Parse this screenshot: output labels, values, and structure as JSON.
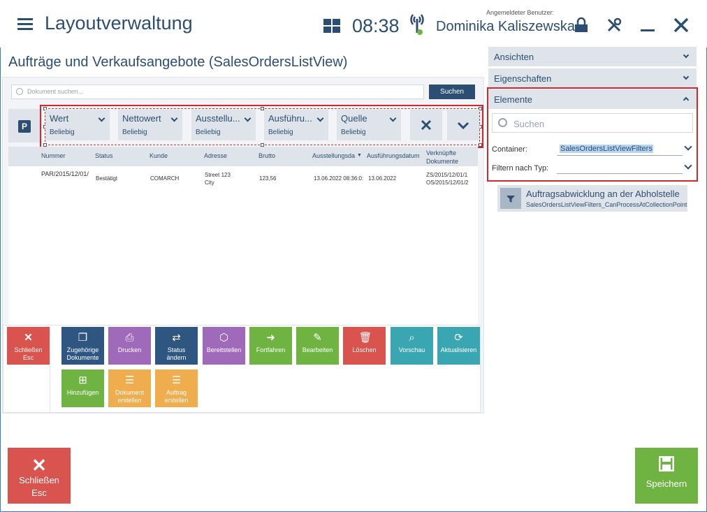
{
  "header": {
    "app_title": "Layoutverwaltung",
    "time": "08:38",
    "user_caption": "Angemeldeter Benutzer:",
    "user_name": "Dominika Kaliszewska"
  },
  "view": {
    "title": "Aufträge und Verkaufsangebote (SalesOrdersListView)",
    "search_placeholder": "Dokument suchen...",
    "search_button": "Suchen",
    "p_button": "P"
  },
  "filters": [
    {
      "name": "Wert",
      "value": "Beliebig"
    },
    {
      "name": "Nettowert",
      "value": "Beliebig"
    },
    {
      "name": "Ausstellu...",
      "value": "Beliebig"
    },
    {
      "name": "Ausführu...",
      "value": "Beliebig"
    },
    {
      "name": "Quelle",
      "value": "Beliebig"
    }
  ],
  "table": {
    "columns": [
      "Nummer",
      "Status",
      "Kunde",
      "Adresse",
      "Brutto",
      "Ausstellungsda",
      "Ausführungsdatum",
      "Verknüpfte Dokumente"
    ],
    "rows": [
      {
        "number": "PAR/2015/12/01/",
        "status": "Bestätigt",
        "customer": "COMARCH",
        "address_line1": "Street 123",
        "address_line2": "City",
        "gross": "123,56",
        "issue_date": "13.06.2022 08:36:0:",
        "exec_date": "13.06.2022",
        "linked1": "ZS/2015/12/01/1",
        "linked2": "OS/2015/12/01/2"
      }
    ]
  },
  "actions": {
    "close": [
      "Schließen",
      "Esc"
    ],
    "tiles": [
      {
        "line1": "Zugehörige",
        "line2": "Dokumente",
        "color": "#2e5680"
      },
      {
        "line1": "Drucken",
        "line2": "",
        "color": "#a06aba"
      },
      {
        "line1": "Status",
        "line2": "ändern",
        "color": "#2e5680"
      },
      {
        "line1": "Bereitstellen",
        "line2": "",
        "color": "#a06aba"
      },
      {
        "line1": "Fortfahren",
        "line2": "",
        "color": "#6fb443"
      },
      {
        "line1": "Bearbeiten",
        "line2": "",
        "color": "#6fb443"
      },
      {
        "line1": "Löschen",
        "line2": "",
        "color": "#d9534f"
      },
      {
        "line1": "Vorschau",
        "line2": "",
        "color": "#3aa6b1"
      },
      {
        "line1": "Aktualisieren",
        "line2": "",
        "color": "#3aa6b1"
      },
      {
        "line1": "Hinzufügen",
        "line2": "",
        "color": "#6fb443"
      },
      {
        "line1": "Dokument",
        "line2": "erstellen",
        "color": "#f0ad4e"
      },
      {
        "line1": "Auftrag",
        "line2": "erstellen",
        "color": "#f0ad4e"
      }
    ]
  },
  "footer": {
    "close_label": "Schließen",
    "close_key": "Esc",
    "save_label": "Speichern"
  },
  "right_panel": {
    "sections": [
      "Ansichten",
      "Eigenschaften",
      "Elemente"
    ],
    "search_placeholder": "Suchen",
    "container_label": "Container:",
    "container_value": "SalesOrdersListViewFilters",
    "filter_type_label": "Filtern nach Typ:",
    "filter_type_value": "",
    "element_title": "Auftragsabwicklung an der Abholstelle",
    "element_subtitle": "SalesOrdersListViewFilters_CanProcessAtCollectionPoint"
  }
}
